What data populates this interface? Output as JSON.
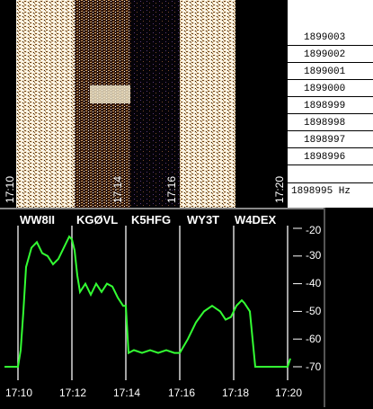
{
  "waterfall": {
    "times": [
      "17:10",
      "17:14",
      "17:16",
      "17:20"
    ],
    "freq_labels": [
      "1899003",
      "1899002",
      "1899001",
      "1899000",
      "1898999",
      "1898998",
      "1898997",
      "1898996",
      "1898995 Hz"
    ]
  },
  "plot": {
    "callsigns": [
      "WW8II",
      "KGØVL",
      "K5HFG",
      "WY3T",
      "W4DEX"
    ],
    "y_ticks": [
      "-20",
      "-30",
      "-40",
      "-50",
      "-60",
      "-70"
    ],
    "x_ticks": [
      "17:10",
      "17:12",
      "17:14",
      "17:16",
      "17:18",
      "17:20"
    ],
    "trace_color": "#33ff33"
  },
  "chart_data": {
    "type": "line",
    "title": "",
    "xlabel": "",
    "ylabel": "",
    "ylim": [
      -70,
      -20
    ],
    "xlim": [
      "17:10",
      "17:20"
    ],
    "grid": true,
    "series": [
      {
        "x": [
          "17:09.5",
          "17:09.8",
          "17:10.0",
          "17:10.1",
          "17:10.2",
          "17:10.3",
          "17:10.5",
          "17:10.7",
          "17:10.9",
          "17:11.1",
          "17:11.3",
          "17:11.5",
          "17:11.7",
          "17:11.9",
          "17:12.0",
          "17:12.1",
          "17:12.2",
          "17:12.3",
          "17:12.5",
          "17:12.7",
          "17:12.9",
          "17:13.1",
          "17:13.3",
          "17:13.5",
          "17:13.7",
          "17:13.9",
          "17:14.0",
          "17:14.1",
          "17:14.3",
          "17:14.6",
          "17:14.9",
          "17:15.2",
          "17:15.5",
          "17:15.8",
          "17:16.0",
          "17:16.3",
          "17:16.6",
          "17:16.9",
          "17:17.2",
          "17:17.5",
          "17:17.7",
          "17:17.9",
          "17:18.1",
          "17:18.3",
          "17:18.4",
          "17:18.6",
          "17:18.8",
          "17:19.1",
          "17:19.4",
          "17:19.7",
          "17:20.0",
          "17:20.1"
        ],
        "values": [
          -70,
          -70,
          -70,
          -64,
          -50,
          -34,
          -27,
          -25,
          -29,
          -30,
          -33,
          -31,
          -27,
          -23,
          -24,
          -28,
          -37,
          -43,
          -40,
          -44,
          -40,
          -43,
          -40,
          -41,
          -45,
          -48,
          -48,
          -65,
          -64,
          -65,
          -64,
          -65,
          -64,
          -65,
          -65,
          -60,
          -54,
          -50,
          -48,
          -50,
          -53,
          -52,
          -48,
          -46,
          -47,
          -50,
          -70,
          -70,
          -70,
          -70,
          -70,
          -67
        ]
      }
    ]
  }
}
